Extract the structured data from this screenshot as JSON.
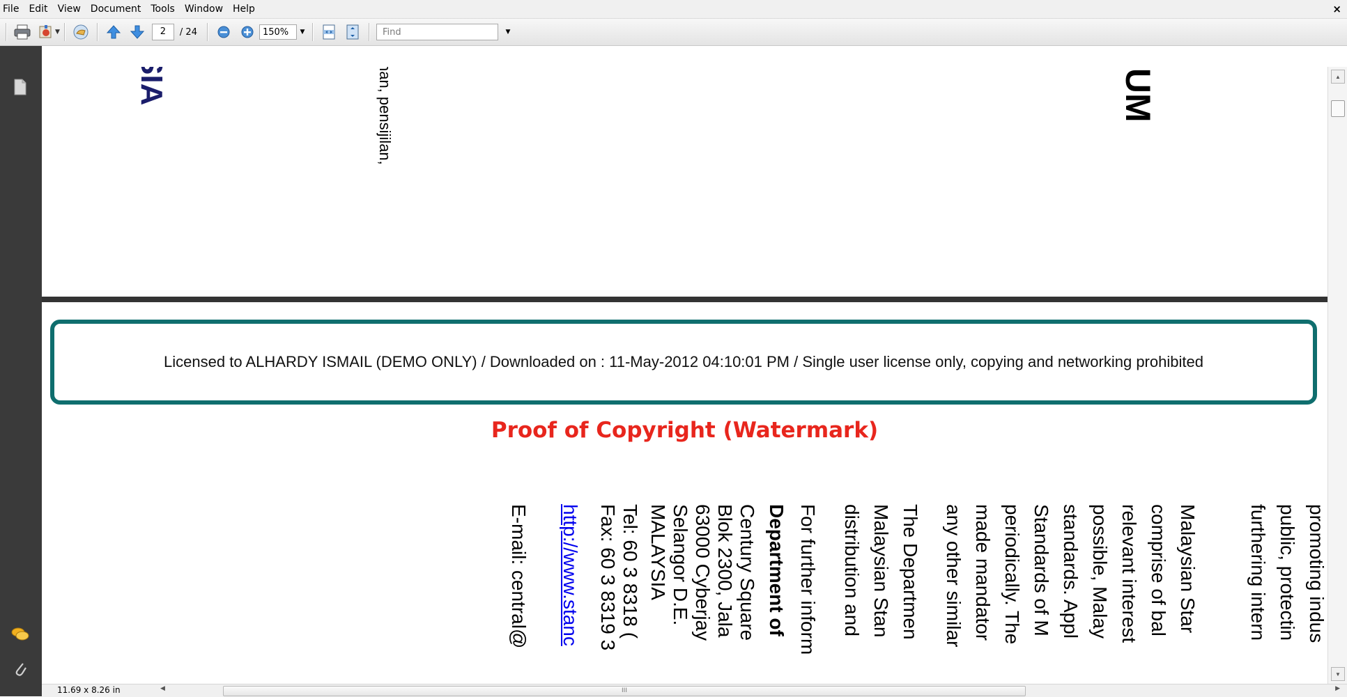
{
  "menu": {
    "items": [
      "File",
      "Edit",
      "View",
      "Document",
      "Tools",
      "Window",
      "Help"
    ],
    "close_glyph": "×"
  },
  "toolbar": {
    "current_page": "2",
    "total_pages": "/ 24",
    "zoom": "150%",
    "find_placeholder": "Find",
    "icons": [
      "print-icon",
      "share-icon",
      "hand-collaborate-icon",
      "previous-page-icon",
      "next-page-icon",
      "zoom-out-icon",
      "zoom-in-icon",
      "fit-width-icon",
      "fit-page-icon"
    ]
  },
  "left_panel": {
    "icons": [
      "pages-icon",
      "comments-icon",
      "attachments-icon"
    ]
  },
  "document": {
    "top_rotated": {
      "sia": "SIA",
      "pensijilan": "nan, pensijilan,",
      "ium": "IUM"
    },
    "watermark": "Licensed to ALHARDY ISMAIL (DEMO ONLY) / Downloaded on : 11-May-2012 04:10:01 PM / Single user license only, copying and networking prohibited",
    "annotation": "Proof of Copyright (Watermark)",
    "rotated_columns": [
      "promoting indus",
      "public, protectin",
      "furthering intern",
      "Malaysian Star",
      "comprise of bal",
      "relevant interest",
      "possible, Malay",
      "standards. Appl",
      "Standards of M",
      "periodically. The",
      "made mandator",
      "any other similar",
      "The Departmen",
      "Malaysian Stan",
      "distribution and",
      "For further inform",
      "Department of",
      "Century Square",
      "Blok 2300, Jala",
      "63000 Cyberjay",
      "Selangor D.E.",
      "MALAYSIA",
      "Tel: 60 3 8318 (",
      "Fax: 60 3 8319 3",
      "http://www.stanc",
      "E-mail: central@"
    ]
  },
  "statusbar": {
    "page_size": "11.69 x 8.26 in",
    "scroll_grip": "III"
  },
  "colors": {
    "callout_border": "#0f6e6e",
    "annotation_red": "#e8261d",
    "left_panel": "#3a3a3a"
  }
}
